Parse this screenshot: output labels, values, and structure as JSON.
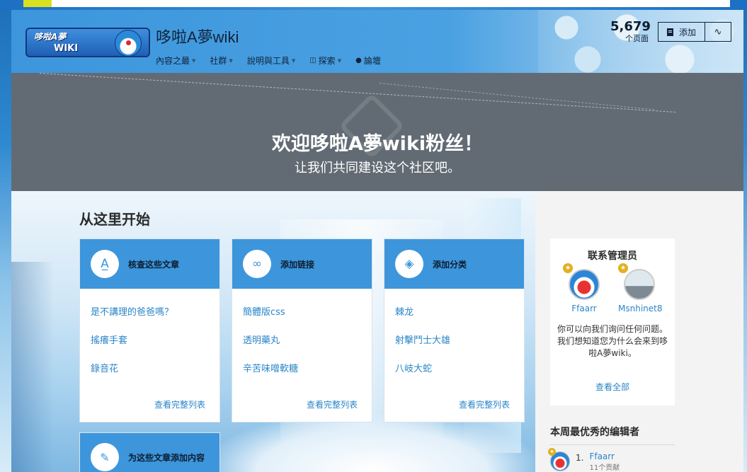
{
  "site": {
    "title": "哆啦A夢wiki",
    "logo_text_top": "哆啦A夢",
    "logo_text_bottom": "WIKI"
  },
  "nav": [
    {
      "label": "內容之最"
    },
    {
      "label": "社群"
    },
    {
      "label": "說明與工具"
    },
    {
      "label": "探索"
    },
    {
      "label": "論壇"
    }
  ],
  "page_count": {
    "number": "5,679",
    "label": "个页面"
  },
  "toolbar": {
    "add_label": "添加"
  },
  "hero": {
    "title": "欢迎哆啦A夢wiki粉丝！",
    "subtitle": "让我们共同建设这个社区吧。"
  },
  "start": {
    "title": "从这里开始",
    "cards": [
      {
        "title": "核查这些文章",
        "links": [
          "是不講理的爸爸嗎？",
          "搖癢手套",
          "錄音花"
        ],
        "more": "查看完整列表"
      },
      {
        "title": "添加链接",
        "links": [
          "簡體版css",
          "透明藥丸",
          "辛苦味噌軟糖"
        ],
        "more": "查看完整列表"
      },
      {
        "title": "添加分类",
        "links": [
          "棘龙",
          "射擊鬥士大雄",
          "八岐大蛇"
        ],
        "more": "查看完整列表"
      }
    ],
    "small_card": {
      "title": "为这些文章添加内容"
    }
  },
  "admins": {
    "title": "联系管理员",
    "users": [
      {
        "name": "Ffaarr"
      },
      {
        "name": "Msnhinet8"
      }
    ],
    "description": "你可以向我们询问任何问题。我们想知道您为什么会来到哆啦A夢wiki。",
    "view_all": "查看全部"
  },
  "top_editors": {
    "title": "本周最优秀的编辑者",
    "list": [
      {
        "rank": "1.",
        "name": "Ffaarr",
        "edits": "11个贡献"
      }
    ]
  },
  "colors": {
    "accent": "#3d96dc",
    "link": "#2a86c8",
    "hero_bg": "#626b74"
  }
}
